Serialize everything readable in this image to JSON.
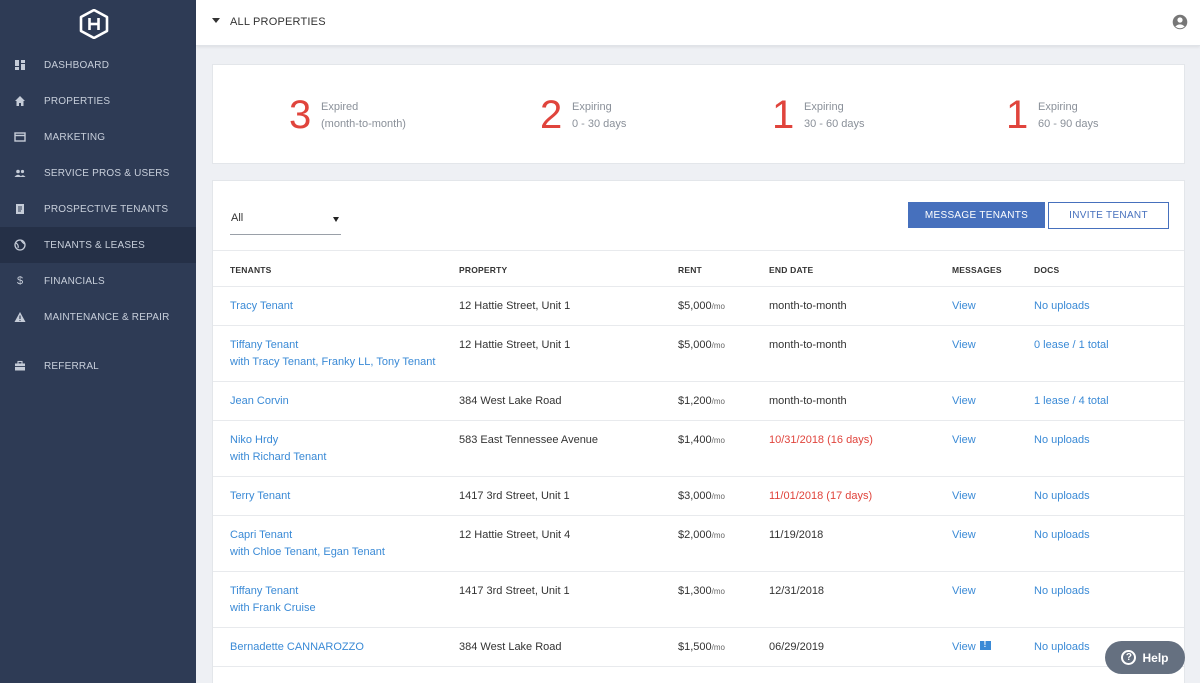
{
  "sidebar": {
    "items": [
      {
        "label": "DASHBOARD",
        "icon": "dashboard-icon"
      },
      {
        "label": "PROPERTIES",
        "icon": "home-icon"
      },
      {
        "label": "MARKETING",
        "icon": "browser-icon"
      },
      {
        "label": "SERVICE PROS & USERS",
        "icon": "users-icon"
      },
      {
        "label": "PROSPECTIVE TENANTS",
        "icon": "clipboard-icon"
      },
      {
        "label": "TENANTS & LEASES",
        "icon": "globe-icon"
      },
      {
        "label": "FINANCIALS",
        "icon": "dollar-icon"
      },
      {
        "label": "MAINTENANCE & REPAIR",
        "icon": "warning-icon"
      },
      {
        "label": "REFERRAL",
        "icon": "briefcase-icon"
      }
    ],
    "active": "TENANTS & LEASES"
  },
  "header": {
    "property_selector": "ALL PROPERTIES"
  },
  "summary": [
    {
      "count": "3",
      "line1": "Expired",
      "line2": "(month-to-month)"
    },
    {
      "count": "2",
      "line1": "Expiring",
      "line2": "0 - 30 days"
    },
    {
      "count": "1",
      "line1": "Expiring",
      "line2": "30 - 60 days"
    },
    {
      "count": "1",
      "line1": "Expiring",
      "line2": "60 - 90 days"
    }
  ],
  "toolbar": {
    "filter_value": "All",
    "message_label": "MESSAGE TENANTS",
    "invite_label": "INVITE TENANT"
  },
  "table": {
    "headers": {
      "tenants": "TENANTS",
      "property": "PROPERTY",
      "rent": "RENT",
      "end_date": "END DATE",
      "messages": "MESSAGES",
      "docs": "DOCS"
    },
    "rent_unit": "/mo",
    "rows": [
      {
        "tenant": "Tracy Tenant",
        "with": "",
        "property": "12 Hattie Street, Unit 1",
        "rent": "$5,000",
        "end_date": "month-to-month",
        "messages": "View",
        "docs": "No uploads"
      },
      {
        "tenant": "Tiffany Tenant",
        "with": "with Tracy Tenant, Franky LL, Tony Tenant",
        "property": "12 Hattie Street, Unit 1",
        "rent": "$5,000",
        "end_date": "month-to-month",
        "messages": "View",
        "docs": "0 lease / 1 total"
      },
      {
        "tenant": "Jean Corvin",
        "with": "",
        "property": "384 West Lake Road",
        "rent": "$1,200",
        "end_date": "month-to-month",
        "messages": "View",
        "docs": "1 lease / 4 total"
      },
      {
        "tenant": "Niko Hrdy",
        "with": "with Richard Tenant",
        "property": "583 East Tennessee Avenue",
        "rent": "$1,400",
        "end_date": "10/31/2018 (16 days)",
        "messages": "View",
        "docs": "No uploads"
      },
      {
        "tenant": "Terry Tenant",
        "with": "",
        "property": "1417 3rd Street, Unit 1",
        "rent": "$3,000",
        "end_date": "11/01/2018 (17 days)",
        "messages": "View",
        "docs": "No uploads"
      },
      {
        "tenant": "Capri Tenant",
        "with": "with Chloe Tenant, Egan Tenant",
        "property": "12 Hattie Street, Unit 4",
        "rent": "$2,000",
        "end_date": "11/19/2018",
        "messages": "View",
        "docs": "No uploads"
      },
      {
        "tenant": "Tiffany Tenant",
        "with": "with Frank Cruise",
        "property": "1417 3rd Street, Unit 1",
        "rent": "$1,300",
        "end_date": "12/31/2018",
        "messages": "View",
        "docs": "No uploads"
      },
      {
        "tenant": "Bernadette CANNAROZZO",
        "with": "",
        "property": "384 West Lake Road",
        "rent": "$1,500",
        "end_date": "06/29/2019",
        "messages": "View",
        "docs": "No uploads"
      }
    ]
  },
  "help": {
    "label": "Help"
  },
  "colors": {
    "sidebar_bg": "#2e3b55",
    "accent": "#4670bd",
    "link": "#3a8ad6",
    "alert": "#e0443c"
  }
}
